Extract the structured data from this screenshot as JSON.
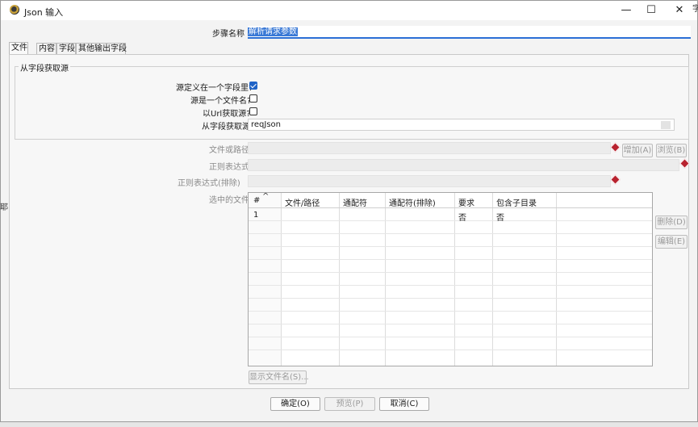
{
  "window": {
    "title": "Json 输入",
    "min": "—",
    "max": "☐",
    "close": "✕"
  },
  "step": {
    "label": "步骤名称",
    "value": "解析请求参数"
  },
  "tabs": [
    "文件",
    "内容",
    "字段",
    "其他输出字段"
  ],
  "source_group": {
    "title": "从字段获取源",
    "defined_in_field": {
      "label": "源定义在一个字段里?",
      "checked": true
    },
    "is_filename": {
      "label": "源是一个文件名?",
      "checked": false
    },
    "from_url": {
      "label": "以Url获取源?",
      "checked": false
    },
    "get_from_field": {
      "label": "从字段获取源",
      "value": "reqJson"
    }
  },
  "file_section": {
    "file_or_path_label": "文件或路径",
    "regex_label": "正则表达式",
    "regex_exclude_label": "正则表达式(排除)",
    "selected_files_label": "选中的文件",
    "add_button": "增加(A)",
    "browse_button": "浏览(B)",
    "delete_button": "删除(D)",
    "edit_button": "编辑(E)",
    "show_filenames_button": "显示文件名(S)..."
  },
  "files_table": {
    "headers": [
      "#",
      "文件/路径",
      "通配符",
      "通配符(排除)",
      "要求",
      "包含子目录"
    ],
    "sort_indicator": "^",
    "rows": [
      {
        "num": "1",
        "path": "",
        "wildcard": "",
        "exclude": "",
        "required": "否",
        "subdirs": "否"
      }
    ]
  },
  "footer": {
    "ok": "确定(O)",
    "preview": "预览(P)",
    "cancel": "取消(C)"
  },
  "background_fragments": {
    "left": "耶",
    "right": "字"
  }
}
